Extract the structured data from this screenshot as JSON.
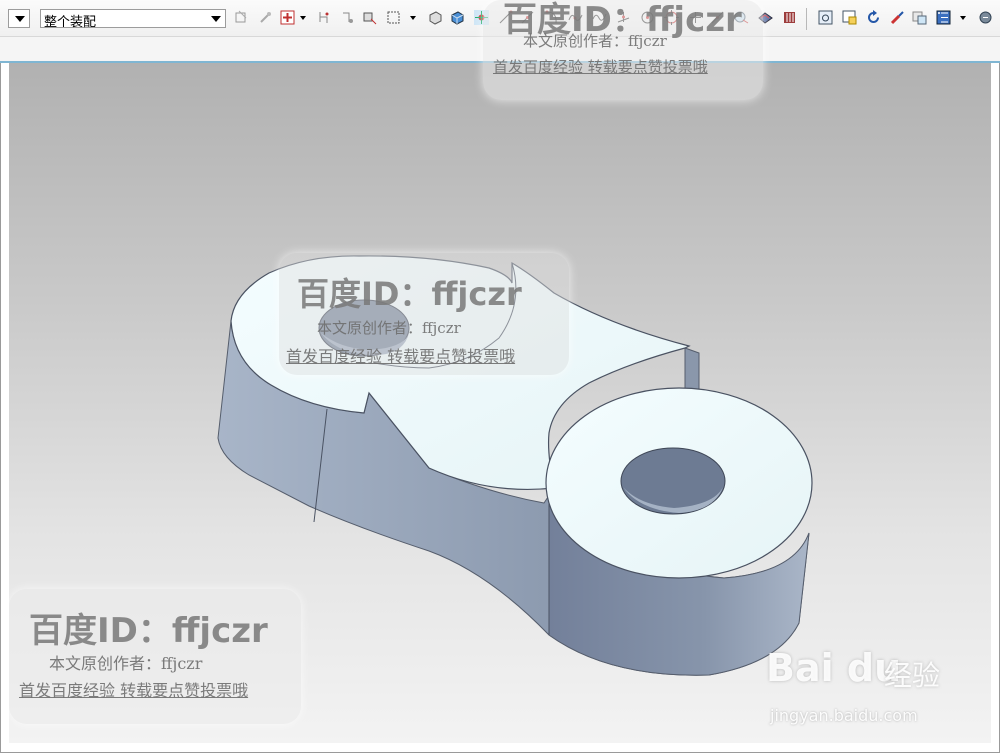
{
  "toolbar": {
    "assembly_scope": "整个装配",
    "icons": [
      "dropdown-arrow",
      "dim-icon",
      "edit-icon",
      "snap-point-icon",
      "drag-icon",
      "component-icon",
      "select-box-icon",
      "view-icon",
      "cube-shaded-icon",
      "snap-control-icon",
      "line-icon",
      "arc-icon",
      "spline-icon",
      "wave-icon",
      "perpendicular-icon",
      "circle-center-icon",
      "quadrant-icon",
      "cross-icon",
      "tangent-icon",
      "point-icon",
      "layer-icon",
      "view-triad-icon",
      "window-icon",
      "rotate-icon",
      "brush-icon",
      "shading-icon",
      "grid-icon",
      "more-icon"
    ]
  },
  "watermarks": [
    {
      "id": "百度ID：ffjczr",
      "line2": "本文原创作者：ffjczr",
      "line3": "首发百度经验  转载要点赞投票哦"
    },
    {
      "id": "百度ID：ffjczr",
      "line2": "本文原创作者：ffjczr",
      "line3": "首发百度经验  转载要点赞投票哦"
    },
    {
      "id": "百度ID：ffjczr",
      "line2": "本文原创作者：ffjczr",
      "line3": "首发百度经验  转载要点赞投票哦"
    }
  ],
  "baidu_logo": {
    "brand": "Bai du",
    "cn": "经验",
    "url": "jingyan.baidu.com"
  },
  "colors": {
    "part_top": "#eef9fb",
    "part_side": "#7e8ea4",
    "viewport_top": "#b1b1b1",
    "viewport_bottom": "#f3f3f3",
    "accent_line": "#7fb6d3"
  }
}
